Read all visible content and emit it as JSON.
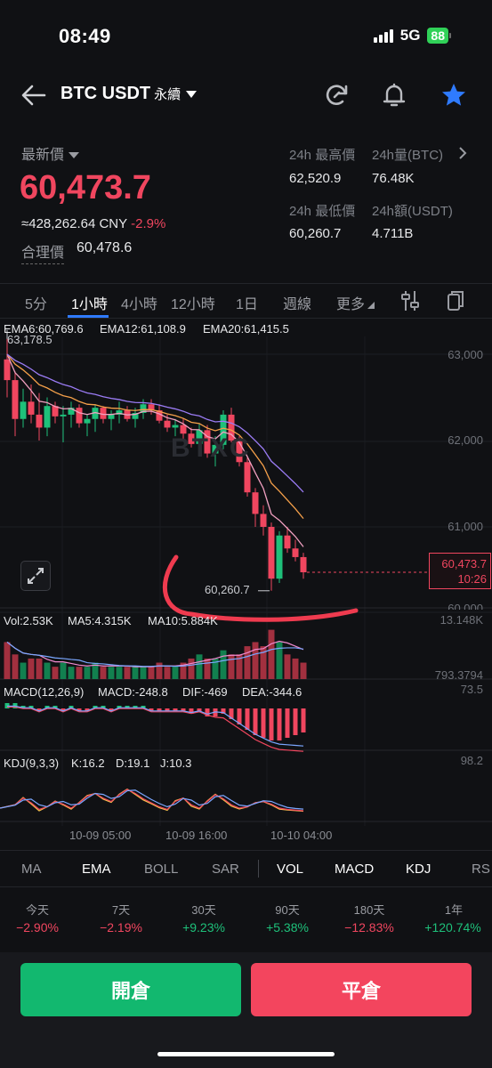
{
  "status_bar": {
    "time": "08:49",
    "network": "5G",
    "battery": "88"
  },
  "header": {
    "pair": "BTC USDT",
    "contract": "永續",
    "icons": [
      "back-arrow-icon",
      "refresh-icon",
      "bell-icon",
      "star-icon"
    ]
  },
  "ticker": {
    "last_label": "最新價",
    "last_price": "60,473.7",
    "cny": "≈428,262.64 CNY",
    "change_pct": "-2.9%",
    "fair_label": "合理價",
    "fair_price": "60,478.6",
    "stats": [
      {
        "label": "24h 最高價",
        "value": "62,520.9"
      },
      {
        "label": "24h量(BTC)",
        "value": "76.48K"
      },
      {
        "label": "24h 最低價",
        "value": "60,260.7"
      },
      {
        "label": "24h額(USDT)",
        "value": "4.711B"
      }
    ]
  },
  "intervals": {
    "items": [
      "5分",
      "1小時",
      "4小時",
      "12小時",
      "1日",
      "週線",
      "更多"
    ],
    "active": "1小時"
  },
  "chart_data": {
    "type": "candlestick",
    "ema_legend": [
      {
        "name": "EMA6:60,769.6",
        "color": "#f0a0c0"
      },
      {
        "name": "EMA12:61,108.9",
        "color": "#f5a04a"
      },
      {
        "name": "EMA20:61,415.5",
        "color": "#9b7cf5"
      }
    ],
    "y_ticks": [
      "63,000",
      "62,000",
      "61,000",
      "60,000"
    ],
    "x_ticks": [
      "10-09 05:00",
      "10-09 16:00",
      "10-10 04:00"
    ],
    "high_label": "63,178.5",
    "low_label": "60,260.7",
    "current_price": "60,473.7",
    "countdown": "10:26",
    "watermark": "BTXC",
    "candles": [
      [
        62940,
        63178,
        62500,
        62700
      ],
      [
        62700,
        62800,
        62050,
        62250
      ],
      [
        62250,
        62600,
        62150,
        62450
      ],
      [
        62450,
        62650,
        62200,
        62300
      ],
      [
        62300,
        62550,
        62000,
        62150
      ],
      [
        62150,
        62500,
        62050,
        62400
      ],
      [
        62400,
        62450,
        62200,
        62280
      ],
      [
        62280,
        62400,
        61980,
        62300
      ],
      [
        62300,
        62450,
        62150,
        62380
      ],
      [
        62380,
        62420,
        62150,
        62200
      ],
      [
        62200,
        62300,
        62050,
        62250
      ],
      [
        62250,
        62420,
        62100,
        62380
      ],
      [
        62380,
        62400,
        62200,
        62250
      ],
      [
        62250,
        62350,
        62120,
        62300
      ],
      [
        62300,
        62450,
        62200,
        62350
      ],
      [
        62350,
        62400,
        62220,
        62250
      ],
      [
        62250,
        62380,
        62150,
        62320
      ],
      [
        62320,
        62480,
        62250,
        62420
      ],
      [
        62420,
        62480,
        62300,
        62350
      ],
      [
        62350,
        62420,
        62200,
        62230
      ],
      [
        62230,
        62300,
        62100,
        62150
      ],
      [
        62150,
        62250,
        62050,
        62180
      ],
      [
        62180,
        62260,
        62020,
        62080
      ],
      [
        62080,
        62150,
        61920,
        61960
      ],
      [
        61960,
        62200,
        61850,
        62120
      ],
      [
        62120,
        62180,
        61800,
        61850
      ],
      [
        61850,
        62050,
        61700,
        61950
      ],
      [
        61950,
        62350,
        61900,
        62300
      ],
      [
        62300,
        62380,
        61980,
        62000
      ],
      [
        62000,
        62050,
        61700,
        61750
      ],
      [
        61750,
        61800,
        61350,
        61400
      ],
      [
        61400,
        61450,
        61000,
        61150
      ],
      [
        61150,
        61250,
        60900,
        61000
      ],
      [
        61000,
        61050,
        60260,
        60400
      ],
      [
        60400,
        60950,
        60350,
        60900
      ],
      [
        60900,
        61000,
        60700,
        60750
      ],
      [
        60750,
        60850,
        60600,
        60650
      ],
      [
        60650,
        60700,
        60400,
        60474
      ]
    ],
    "volume_legend": [
      {
        "name": "Vol:2.53K",
        "color": "#c9cbd0"
      },
      {
        "name": "MA5:4.315K",
        "color": "#f08ad0"
      },
      {
        "name": "MA10:5.884K",
        "color": "#7aa7ff"
      }
    ],
    "volume_ticks": [
      "13.148K",
      "793.3794"
    ],
    "macd_legend": [
      {
        "name": "MACD(12,26,9)",
        "color": "#c9cbd0"
      },
      {
        "name": "MACD:-248.8",
        "color": "#f5c04a"
      },
      {
        "name": "DIF:-469",
        "color": "#f0465f"
      },
      {
        "name": "DEA:-344.6",
        "color": "#7aa7ff"
      }
    ],
    "macd_tick": "73.5",
    "kdj_legend": [
      {
        "name": "KDJ(9,3,3)",
        "color": "#c9cbd0"
      },
      {
        "name": "K:16.2",
        "color": "#f0465f"
      },
      {
        "name": "D:19.1",
        "color": "#7aa7ff"
      },
      {
        "name": "J:10.3",
        "color": "#f5c04a"
      }
    ],
    "kdj_tick": "98.2"
  },
  "indicators": {
    "items": [
      "MA",
      "EMA",
      "BOLL",
      "SAR",
      "VOL",
      "MACD",
      "KDJ",
      "RS"
    ],
    "active": [
      "EMA",
      "VOL",
      "MACD",
      "KDJ"
    ]
  },
  "performance": [
    {
      "label": "今天",
      "value": "−2.90%",
      "dir": "down"
    },
    {
      "label": "7天",
      "value": "−2.19%",
      "dir": "down"
    },
    {
      "label": "30天",
      "value": "+9.23%",
      "dir": "up"
    },
    {
      "label": "90天",
      "value": "+5.38%",
      "dir": "up"
    },
    {
      "label": "180天",
      "value": "−12.83%",
      "dir": "down"
    },
    {
      "label": "1年",
      "value": "+120.74%",
      "dir": "up"
    }
  ],
  "actions": {
    "open": "開倉",
    "close": "平倉",
    "open_color": "#12b86f",
    "close_color": "#f3455e"
  }
}
